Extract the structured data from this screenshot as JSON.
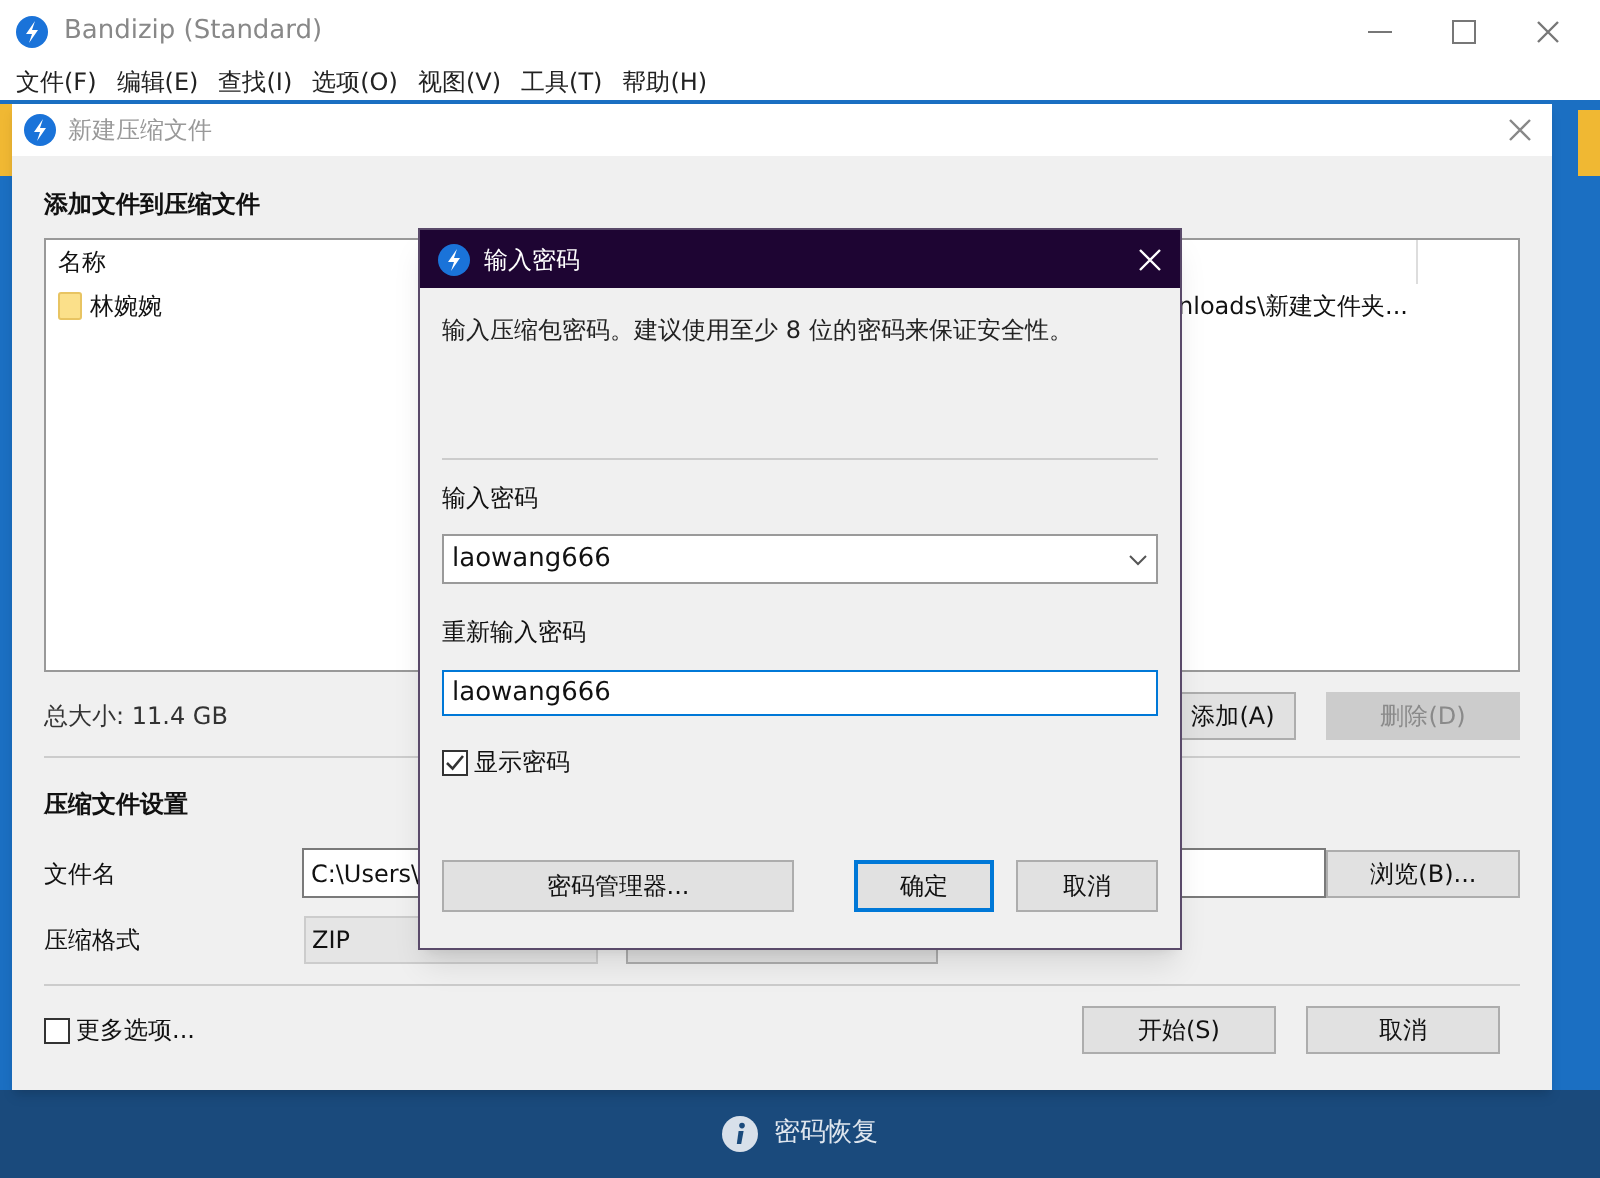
{
  "window": {
    "title": "Bandizip (Standard)"
  },
  "menu": [
    "文件(F)",
    "编辑(E)",
    "查找(I)",
    "选项(O)",
    "视图(V)",
    "工具(T)",
    "帮助(H)"
  ],
  "new_archive_dialog": {
    "title": "新建压缩文件",
    "section_title": "添加文件到压缩文件",
    "file_list": {
      "columns": [
        "名称"
      ],
      "rows": [
        {
          "name": "林婉婉",
          "column_2": "nloads\\新建文件夹..."
        }
      ]
    },
    "total_size": "总大小: 11.4 GB",
    "buttons": [
      {
        "label": "添加(A)",
        "disabled": false
      },
      {
        "label": "删除(D)",
        "disabled": true
      }
    ],
    "settings_title": "压缩文件设置",
    "filename_label": "文件名",
    "filename_value": "C:\\Users\\",
    "browse_button": "浏览(B)...",
    "format_label": "压缩格式",
    "format_value": "ZIP",
    "more_options": {
      "label": "更多选项...",
      "checked": false
    },
    "start_button": "开始(S)",
    "cancel_button": "取消"
  },
  "password_dialog": {
    "title": "输入密码",
    "message": "输入压缩包密码。建议使用至少 8 位的密码来保证安全性。",
    "password_label": "输入密码",
    "password_value": "laowang666",
    "confirm_label": "重新输入密码",
    "confirm_value": "laowang666",
    "show_password": {
      "label": "显示密码",
      "checked": true
    },
    "manager_button": "密码管理器...",
    "ok_button": "确定",
    "cancel_button": "取消"
  },
  "status_bar": {
    "text": "密码恢复"
  }
}
